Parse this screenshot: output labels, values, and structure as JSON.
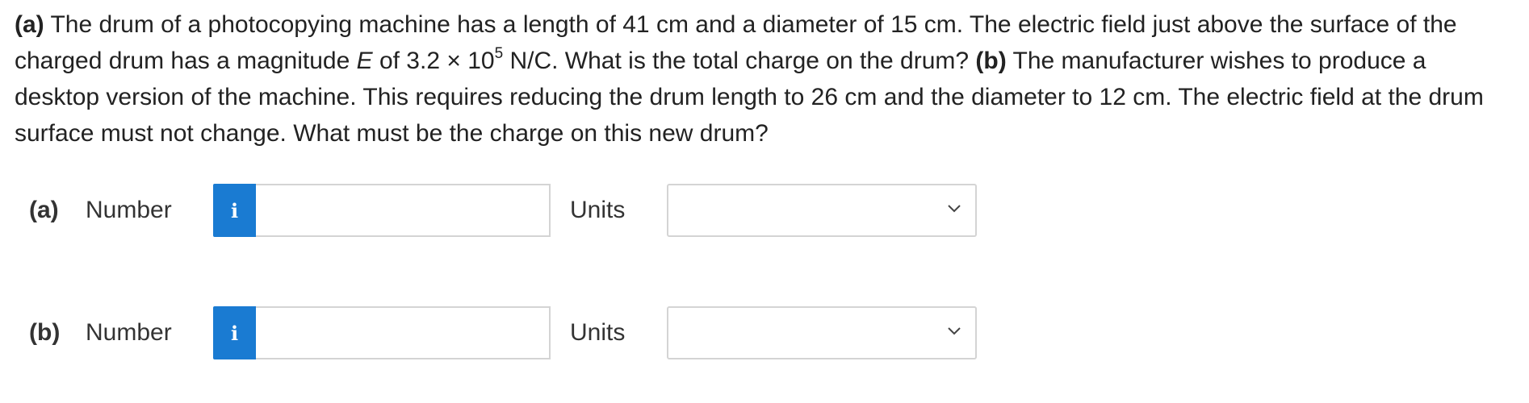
{
  "question": {
    "part_a_tag": "(a)",
    "text_1": " The drum of a photocopying machine has a length of 41 cm and a diameter of 15 cm. The electric field just above the surface of the charged drum has a magnitude ",
    "symbol_E": "E",
    "text_2": " of 3.2 × 10",
    "exponent": "5",
    "text_3": " N/C. What is the total charge on the drum? ",
    "part_b_tag": "(b)",
    "text_4": " The manufacturer wishes to produce a desktop version of the machine. This requires reducing the drum length to 26 cm and the diameter to 12 cm. The electric field at the drum surface must not change. What must be the charge on this new drum?"
  },
  "answers": [
    {
      "part_label": "(a)",
      "number_label": "Number",
      "info_icon": "i",
      "number_value": "",
      "units_label": "Units",
      "units_selected": ""
    },
    {
      "part_label": "(b)",
      "number_label": "Number",
      "info_icon": "i",
      "number_value": "",
      "units_label": "Units",
      "units_selected": ""
    }
  ],
  "colors": {
    "info_button": "#1a7bd2",
    "field_border": "#d4d4d4",
    "text": "#222222"
  },
  "icons": {
    "info": "info-icon",
    "dropdown": "chevron-down-icon"
  }
}
